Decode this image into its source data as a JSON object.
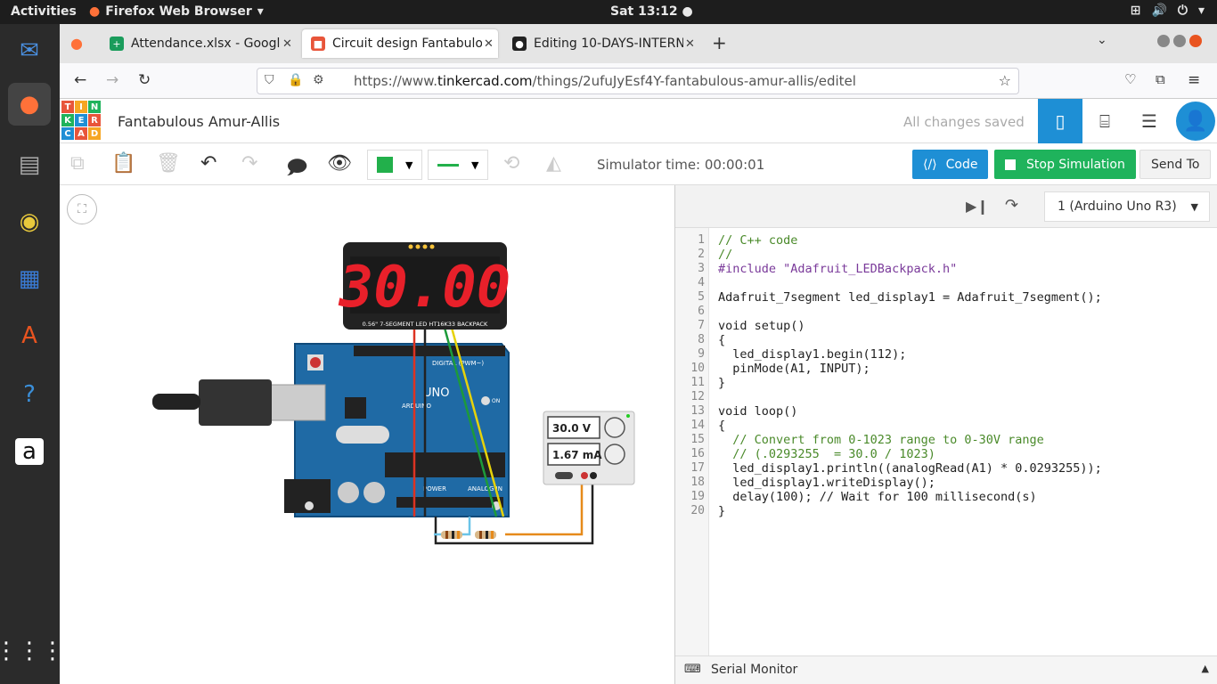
{
  "topbar": {
    "activities": "Activities",
    "app": "Firefox Web Browser",
    "clock": "Sat 13:12 ●"
  },
  "tabs": [
    {
      "label": "Attendance.xlsx - Google",
      "color": "#1a9c5b"
    },
    {
      "label": "Circuit design Fantabulou",
      "color": "#e8553a"
    },
    {
      "label": "Editing 10-DAYS-INTERN",
      "color": "#222222"
    }
  ],
  "url": {
    "prefix": "https://www.",
    "domain": "tinkercad.com",
    "path": "/things/2ufuJyEsf4Y-fantabulous-amur-allis/editel"
  },
  "tinkercad": {
    "logo": [
      "T",
      "I",
      "N",
      "K",
      "E",
      "R",
      "C",
      "A",
      "D"
    ],
    "title": "Fantabulous Amur-Allis",
    "saved": "All changes saved"
  },
  "toolbar": {
    "sim_time": "Simulator time: 00:00:01",
    "code": "Code",
    "stop": "Stop Simulation",
    "send": "Send To",
    "fill_color": "#22b04b"
  },
  "circuit": {
    "display": "30.00",
    "display_caption": "0.56\" 7-SEGMENT LED HT16K33 BACKPACK",
    "meter_v": "30.0 V",
    "meter_a": "1.67 mA",
    "board_labels": {
      "digital": "DIGITAL (PWM~)",
      "power": "POWER",
      "analog": "ANALOG IN",
      "uno": "UNO",
      "arduino": "ARDUINO",
      "on": "ON"
    }
  },
  "device": "1 (Arduino Uno R3)",
  "code_lines": [
    "// C++ code",
    "//",
    "#include \"Adafruit_LEDBackpack.h\"",
    "",
    "Adafruit_7segment led_display1 = Adafruit_7segment();",
    "",
    "void setup()",
    "{",
    "  led_display1.begin(112);",
    "  pinMode(A1, INPUT);",
    "}",
    "",
    "void loop()",
    "{",
    "  // Convert from 0-1023 range to 0-30V range",
    "  // (.0293255  = 30.0 / 1023)",
    "  led_display1.println((analogRead(A1) * 0.0293255));",
    "  led_display1.writeDisplay();",
    "  delay(100); // Wait for 100 millisecond(s)",
    "}"
  ],
  "serial": "Serial Monitor"
}
